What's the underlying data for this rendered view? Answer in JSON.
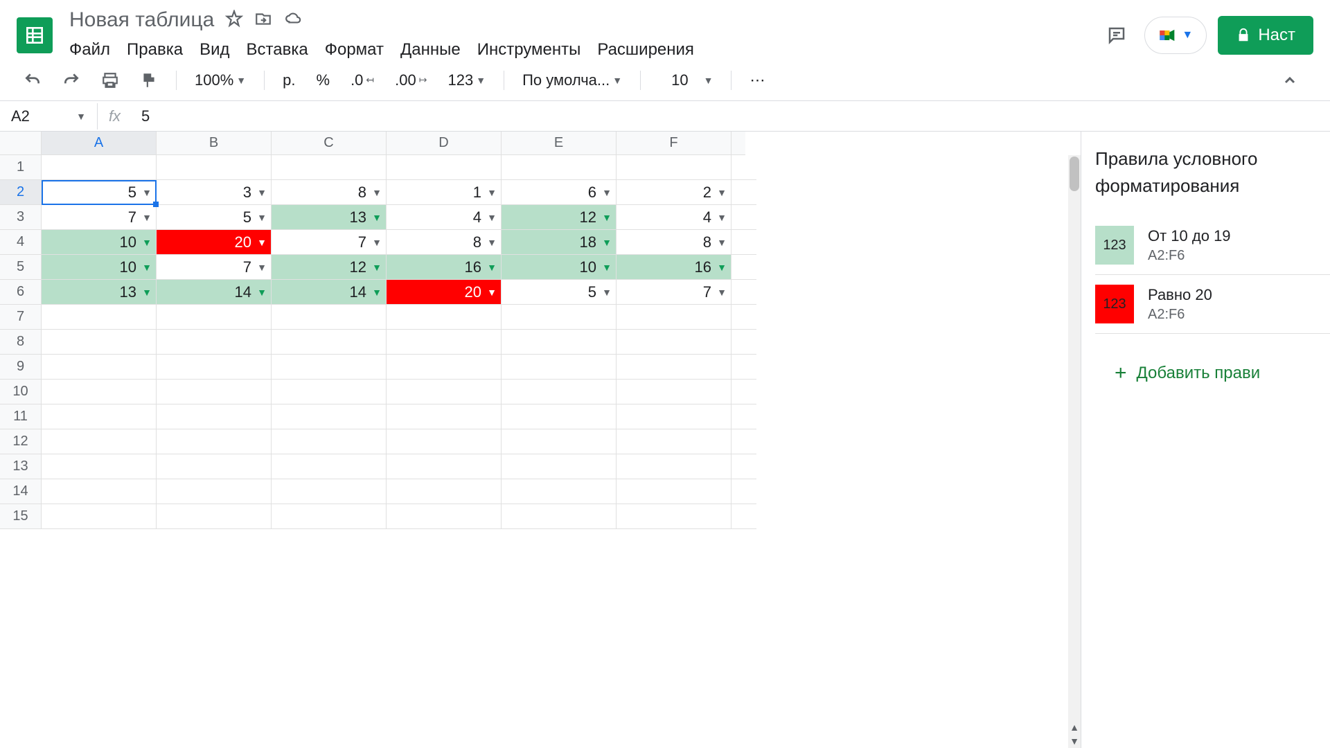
{
  "doc_title": "Новая таблица",
  "menu": [
    "Файл",
    "Правка",
    "Вид",
    "Вставка",
    "Формат",
    "Данные",
    "Инструменты",
    "Расширения"
  ],
  "share_label": "Наст",
  "toolbar": {
    "zoom": "100%",
    "currency": "р.",
    "percent": "%",
    "dec_less": ".0",
    "dec_more": ".00",
    "format_num": "123",
    "font": "По умолча...",
    "font_size": "10",
    "more": "⋯"
  },
  "name_box": "A2",
  "formula_value": "5",
  "columns": [
    "A",
    "B",
    "C",
    "D",
    "E",
    "F"
  ],
  "row_count": 15,
  "selected_cell": {
    "row": 2,
    "col": 0
  },
  "cells": {
    "2": [
      5,
      3,
      8,
      1,
      6,
      2
    ],
    "3": [
      7,
      5,
      13,
      4,
      12,
      4
    ],
    "4": [
      10,
      20,
      7,
      8,
      18,
      8
    ],
    "5": [
      10,
      7,
      12,
      16,
      10,
      16
    ],
    "6": [
      13,
      14,
      14,
      20,
      5,
      7
    ]
  },
  "panel": {
    "title_l1": "Правила условного",
    "title_l2": "форматирования",
    "rules": [
      {
        "swatch": "123",
        "swatch_class": "g",
        "name": "От 10 до 19",
        "range": "A2:F6"
      },
      {
        "swatch": "123",
        "swatch_class": "r",
        "name": "Равно 20",
        "range": "A2:F6"
      }
    ],
    "add_label": "Добавить прави"
  }
}
